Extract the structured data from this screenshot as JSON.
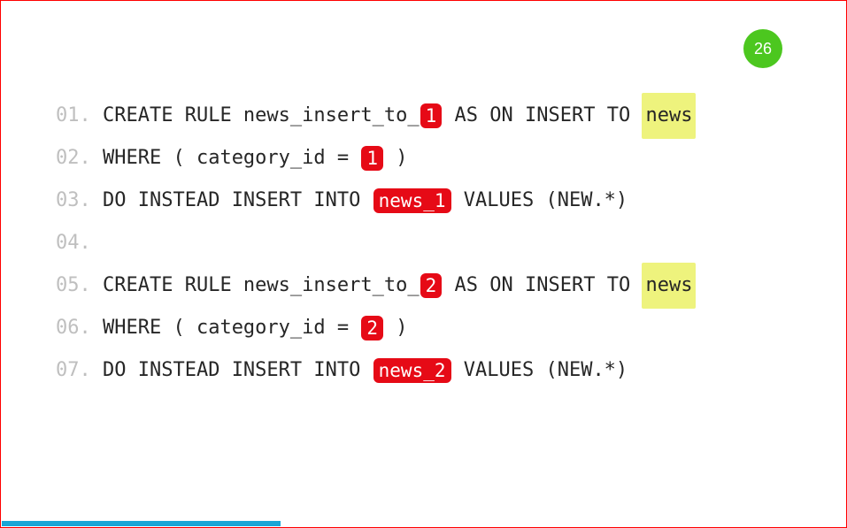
{
  "page_number": "26",
  "progress_percent": 33,
  "code": {
    "lines": [
      {
        "num": "01.",
        "segments": [
          {
            "t": "text",
            "v": " CREATE RULE news_insert_to_"
          },
          {
            "t": "pill",
            "v": "1"
          },
          {
            "t": "text",
            "v": " AS ON INSERT TO "
          },
          {
            "t": "hl",
            "v": "news"
          }
        ]
      },
      {
        "num": "02.",
        "segments": [
          {
            "t": "text",
            "v": " WHERE ( category_id = "
          },
          {
            "t": "pill",
            "v": "1"
          },
          {
            "t": "text",
            "v": " )"
          }
        ]
      },
      {
        "num": "03.",
        "segments": [
          {
            "t": "text",
            "v": " DO INSTEAD INSERT INTO "
          },
          {
            "t": "pill",
            "v": "news_1"
          },
          {
            "t": "text",
            "v": " VALUES (NEW.*)"
          }
        ]
      },
      {
        "num": "04.",
        "segments": []
      },
      {
        "num": "05.",
        "segments": [
          {
            "t": "text",
            "v": " CREATE RULE news_insert_to_"
          },
          {
            "t": "pill",
            "v": "2"
          },
          {
            "t": "text",
            "v": " AS ON INSERT TO "
          },
          {
            "t": "hl",
            "v": "news"
          }
        ]
      },
      {
        "num": "06.",
        "segments": [
          {
            "t": "text",
            "v": " WHERE ( category_id = "
          },
          {
            "t": "pill",
            "v": "2"
          },
          {
            "t": "text",
            "v": " )"
          }
        ]
      },
      {
        "num": "07.",
        "segments": [
          {
            "t": "text",
            "v": " DO INSTEAD INSERT INTO "
          },
          {
            "t": "pill",
            "v": "news_2"
          },
          {
            "t": "text",
            "v": " VALUES (NEW.*)"
          }
        ]
      }
    ]
  }
}
